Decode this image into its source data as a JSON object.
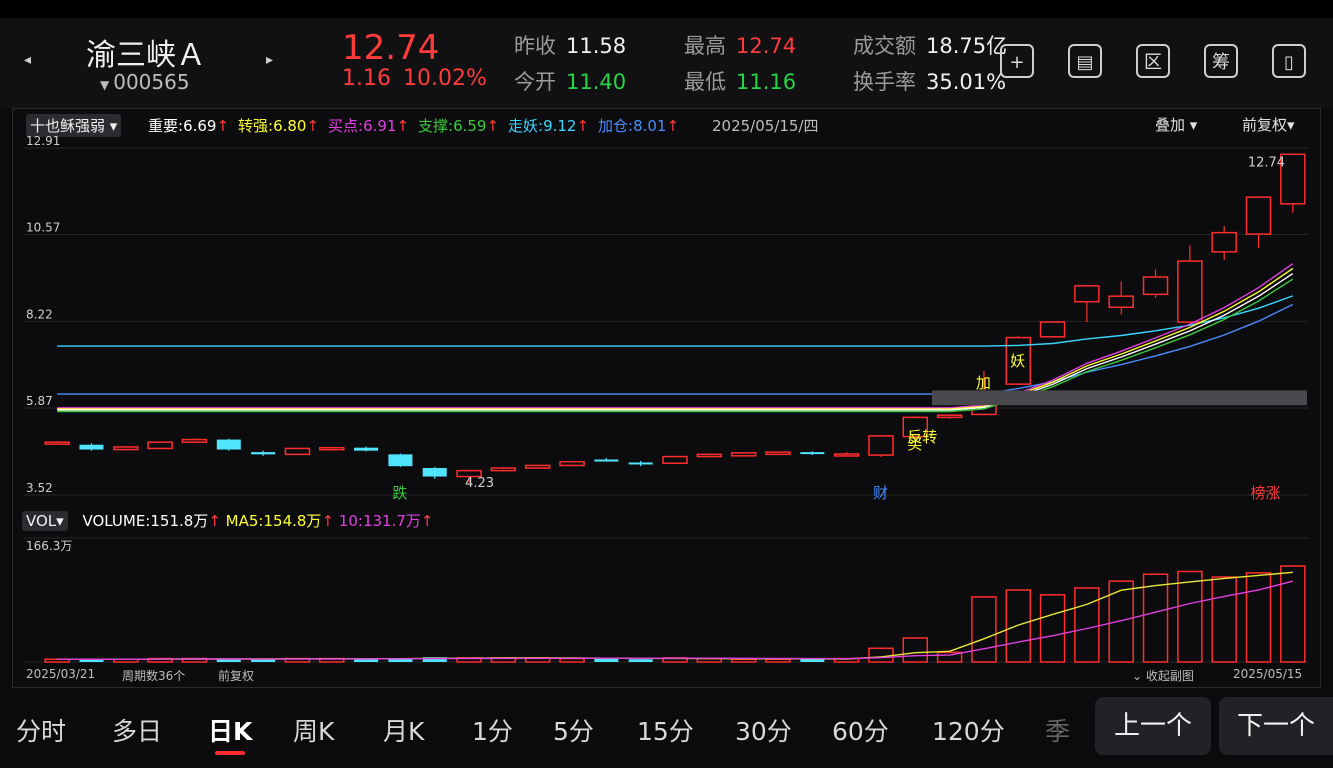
{
  "header": {
    "stock_name": "渝三峡Ａ",
    "stock_code": "000565",
    "price": "12.74",
    "change": "1.16",
    "change_pct": "10.02%",
    "stats": [
      {
        "label": "昨收",
        "value": "11.58",
        "color": "white"
      },
      {
        "label": "今开",
        "value": "11.40",
        "color": "green"
      },
      {
        "label": "最高",
        "value": "12.74",
        "color": "red"
      },
      {
        "label": "最低",
        "value": "11.16",
        "color": "green"
      },
      {
        "label": "成交额",
        "value": "18.75亿",
        "color": "white"
      },
      {
        "label": "换手率",
        "value": "35.01%",
        "color": "white"
      }
    ],
    "tools": [
      "+",
      "▤",
      "区",
      "筹",
      "▯"
    ]
  },
  "indicator": {
    "selector": "十也稣强弱",
    "items": [
      {
        "label": "重要:",
        "value": "6.69",
        "color": "#ffffff"
      },
      {
        "label": "转强:",
        "value": "6.80",
        "color": "#ffff33"
      },
      {
        "label": "买点:",
        "value": "6.91",
        "color": "#e040e0"
      },
      {
        "label": "支撑:",
        "value": "6.59",
        "color": "#3cc83c"
      },
      {
        "label": "走妖:",
        "value": "9.12",
        "color": "#3ad6ff"
      },
      {
        "label": "加仓:",
        "value": "8.01",
        "color": "#4a8cff"
      }
    ],
    "date": "2025/05/15/四",
    "overlay": "叠加",
    "adjust": "前复权"
  },
  "chart_data": {
    "type": "candlestick",
    "y_ticks": [
      "12.91",
      "10.57",
      "8.22",
      "5.87",
      "3.52"
    ],
    "ylim": [
      3.52,
      12.91
    ],
    "candles": [
      [
        4.95,
        4.95,
        4.98,
        4.92
      ],
      [
        4.88,
        4.75,
        4.92,
        4.72
      ],
      [
        4.75,
        4.82,
        4.85,
        4.72
      ],
      [
        4.78,
        4.95,
        4.97,
        4.76
      ],
      [
        4.95,
        5.02,
        5.05,
        4.92
      ],
      [
        5.02,
        4.75,
        5.04,
        4.72
      ],
      [
        4.68,
        4.62,
        4.72,
        4.58
      ],
      [
        4.62,
        4.78,
        4.8,
        4.6
      ],
      [
        4.78,
        4.8,
        4.82,
        4.76
      ],
      [
        4.8,
        4.72,
        4.83,
        4.7
      ],
      [
        4.62,
        4.3,
        4.64,
        4.28
      ],
      [
        4.25,
        4.02,
        4.28,
        3.96
      ],
      [
        4.02,
        4.18,
        4.2,
        3.85
      ],
      [
        4.18,
        4.25,
        4.28,
        4.16
      ],
      [
        4.25,
        4.32,
        4.34,
        4.23
      ],
      [
        4.32,
        4.42,
        4.44,
        4.3
      ],
      [
        4.48,
        4.45,
        4.52,
        4.42
      ],
      [
        4.4,
        4.36,
        4.44,
        4.3
      ],
      [
        4.38,
        4.56,
        4.58,
        4.36
      ],
      [
        4.56,
        4.62,
        4.64,
        4.54
      ],
      [
        4.58,
        4.66,
        4.68,
        4.56
      ],
      [
        4.62,
        4.68,
        4.7,
        4.6
      ],
      [
        4.68,
        4.63,
        4.7,
        4.6
      ],
      [
        4.62,
        4.63,
        4.68,
        4.58
      ],
      [
        4.6,
        5.12,
        5.14,
        4.55
      ],
      [
        5.1,
        5.62,
        5.65,
        5.05
      ],
      [
        5.62,
        5.68,
        5.7,
        5.58
      ],
      [
        5.7,
        6.25,
        6.88,
        5.7
      ],
      [
        6.52,
        7.78,
        7.82,
        6.52
      ],
      [
        7.8,
        8.2,
        8.2,
        7.8
      ],
      [
        8.75,
        9.18,
        9.2,
        8.2
      ],
      [
        8.6,
        8.9,
        9.3,
        8.4
      ],
      [
        8.95,
        9.42,
        9.62,
        8.85
      ],
      [
        8.2,
        9.85,
        10.28,
        8.2
      ],
      [
        10.1,
        10.62,
        10.8,
        9.88
      ],
      [
        10.58,
        11.58,
        11.6,
        10.2
      ],
      [
        11.4,
        12.74,
        12.74,
        11.16
      ]
    ],
    "ma_lines": [
      {
        "name": "走妖",
        "color": "#3ad6ff"
      },
      {
        "name": "加仓",
        "color": "#4a8cff"
      },
      {
        "name": "买点",
        "color": "#e040e0"
      },
      {
        "name": "转强",
        "color": "#ffff33"
      },
      {
        "name": "重要",
        "color": "#ffffff"
      },
      {
        "name": "支撑",
        "color": "#3cc83c"
      }
    ],
    "low_label": "4.23",
    "high_label": "12.74",
    "markers": [
      {
        "text": "跌",
        "color": "#3cc83c"
      },
      {
        "text": "财",
        "color": "#4a8cff"
      },
      {
        "text": "榜涨",
        "color": "#ff3b3b"
      },
      {
        "text": "反转",
        "color": "#ffff33"
      },
      {
        "text": "买",
        "color": "#ffff33"
      },
      {
        "text": "加",
        "color": "#ffff33"
      },
      {
        "text": "妖",
        "color": "#ffff33"
      }
    ],
    "volume": {
      "max_label": "166.3万",
      "values": [
        4,
        4,
        4,
        5,
        5,
        4,
        4,
        5,
        5,
        5,
        5,
        7,
        6,
        6,
        6,
        5,
        5,
        4,
        6,
        5,
        4,
        4,
        4,
        5,
        20,
        35,
        14,
        95,
        105,
        98,
        108,
        118,
        128,
        132,
        124,
        130,
        140
      ],
      "ma5_label": "154.8万",
      "ma10_label": "131.7万",
      "volume_label": "151.8万"
    }
  },
  "volume_bar": {
    "selector": "VOL",
    "volume_name": "VOLUME:",
    "ma5_name": "MA5:",
    "ma10_name": "10:"
  },
  "footer": {
    "start_date": "2025/03/21",
    "period_count": "周期数36个",
    "adjust": "前复权",
    "collapse": "收起副图",
    "end_date": "2025/05/15"
  },
  "periods": [
    "分时",
    "多日",
    "日K",
    "周K",
    "月K",
    "1分",
    "5分",
    "15分",
    "30分",
    "60分",
    "120分",
    "季"
  ],
  "active_period": "日K",
  "prev_button": "上一个",
  "next_button": "下一个"
}
